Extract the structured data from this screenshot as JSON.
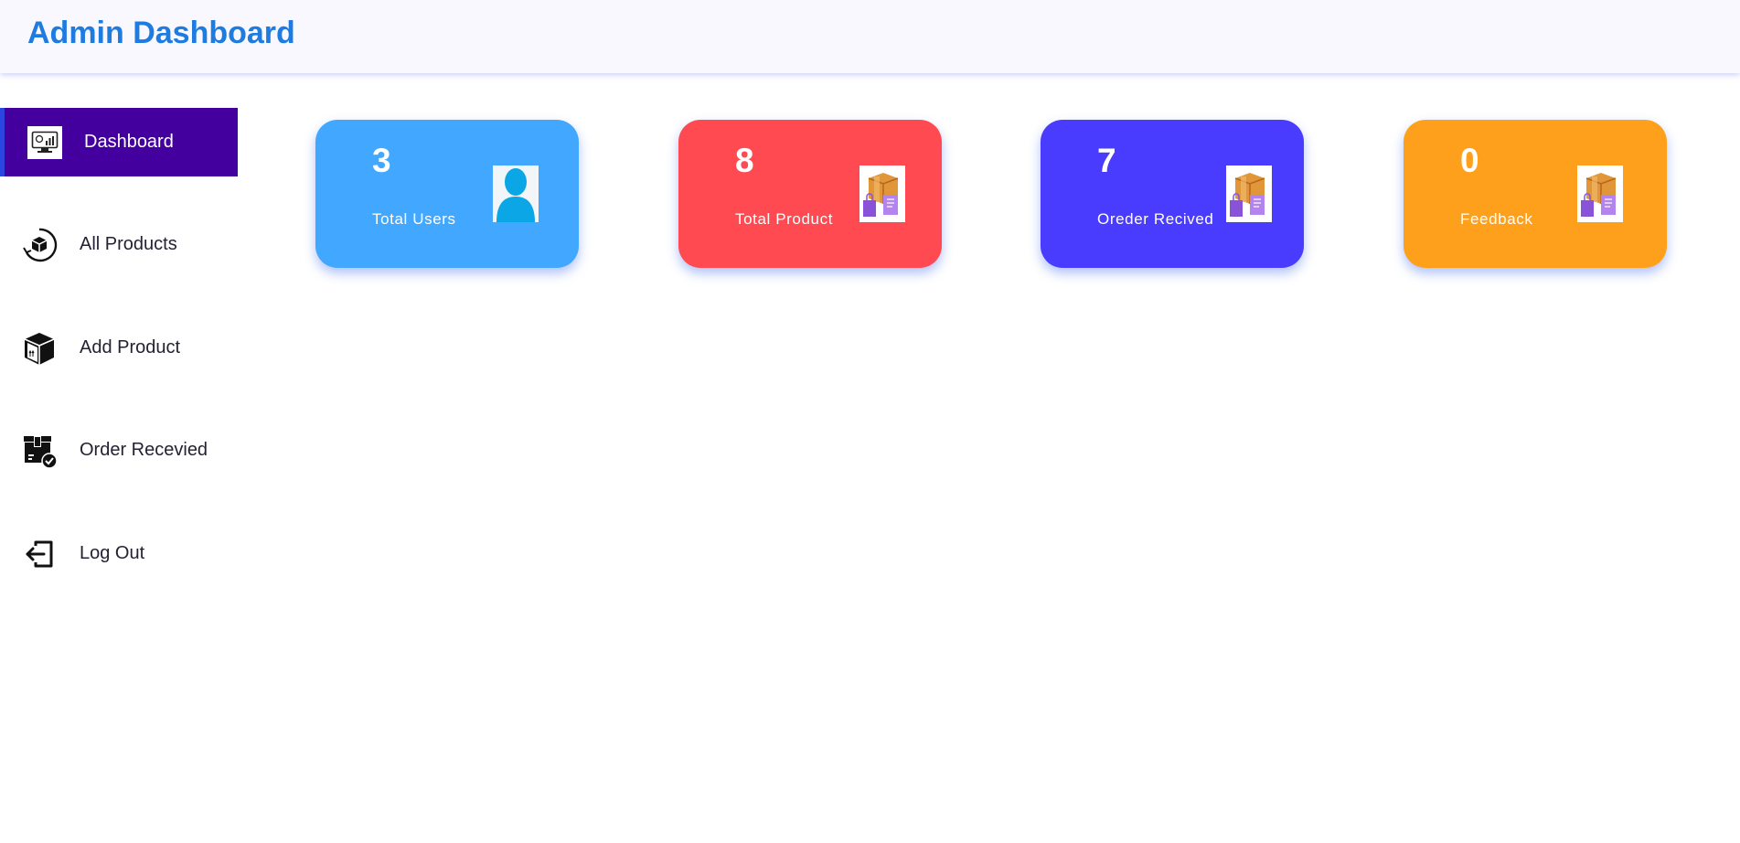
{
  "header": {
    "title": "Admin Dashboard"
  },
  "sidebar": {
    "items": [
      {
        "label": "Dashboard",
        "icon": "dashboard-monitor-icon",
        "active": true
      },
      {
        "label": "All Products",
        "icon": "box-circle-icon"
      },
      {
        "label": "Add Product",
        "icon": "package-box-icon"
      },
      {
        "label": "Order Recevied",
        "icon": "order-received-icon"
      },
      {
        "label": "Log Out",
        "icon": "logout-icon"
      }
    ]
  },
  "cards": [
    {
      "value": "3",
      "label": "Total Users",
      "color": "#42a7ff",
      "icon": "user-avatar-icon"
    },
    {
      "value": "8",
      "label": "Total Product",
      "color": "#ff4a51",
      "icon": "shopping-boxes-icon"
    },
    {
      "value": "7",
      "label": "Oreder Recived",
      "color": "#4a3cff",
      "icon": "shopping-boxes-icon"
    },
    {
      "value": "0",
      "label": "Feedback",
      "color": "#ffa01c",
      "icon": "shopping-boxes-icon"
    }
  ]
}
